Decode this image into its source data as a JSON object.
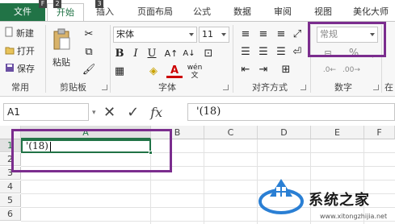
{
  "tabs": {
    "file": "文件",
    "home": "开始",
    "insert": "插入",
    "layout": "页面布局",
    "formulas": "公式",
    "data": "数据",
    "review": "审阅",
    "view": "视图",
    "beautify": "美化大师",
    "keytips": [
      "F",
      "2",
      "3"
    ]
  },
  "ribbon": {
    "common": {
      "new": "新建",
      "open": "打开",
      "save": "保存",
      "label": "常用"
    },
    "clipboard": {
      "paste": "粘贴",
      "label": "剪贴板"
    },
    "font": {
      "name": "宋体",
      "size": "11",
      "bold": "B",
      "italic": "I",
      "underline": "U",
      "color_a": "A",
      "label": "字体",
      "wen": "wén"
    },
    "alignment": {
      "label": "对齐方式"
    },
    "number": {
      "format": "常规",
      "percent": "%",
      "comma": ",",
      "label": "数字"
    },
    "extra_label": "在"
  },
  "formula_bar": {
    "name_box": "A1",
    "cancel": "✕",
    "enter": "✓",
    "fx": "fx",
    "content": "'(18)"
  },
  "grid": {
    "columns": [
      "A",
      "B",
      "C",
      "D",
      "E",
      "F"
    ],
    "rows": [
      "1",
      "2",
      "3",
      "4",
      "5",
      "6"
    ],
    "a1_value": "'(18)"
  },
  "watermark": {
    "text": "系统之家",
    "url": "www.xitongzhijia.net"
  },
  "colors": {
    "accent": "#217346",
    "highlight": "#7b2d8e"
  }
}
